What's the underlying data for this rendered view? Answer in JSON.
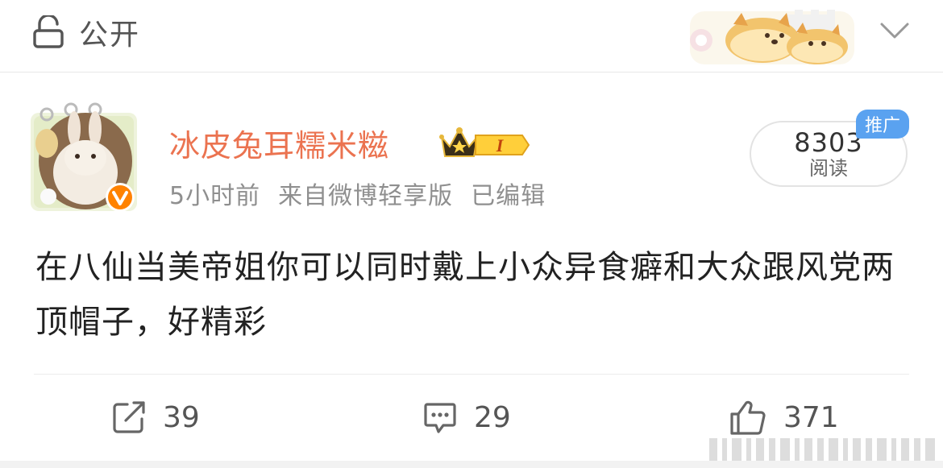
{
  "header": {
    "privacy_icon": "lock-open-icon",
    "privacy_label": "公开",
    "decoration": "shiba-bread-dogs-sticker",
    "menu_icon": "chevron-down-icon"
  },
  "post": {
    "author": {
      "name": "冰皮兔耳糯米糍",
      "avatar": "rabbit-avatar",
      "verified_icon": "orange-verified-badge-icon",
      "vip_badge": "crown-vip-level-badge",
      "vip_level": "I"
    },
    "time": "5小时前",
    "source": "来自微博轻享版",
    "edited": "已编辑",
    "reads": {
      "count": "8303",
      "label": "阅读",
      "promo_label": "推广"
    },
    "text": "在八仙当美帝姐你可以同时戴上小众异食癖和大众跟风党两顶帽子，好精彩"
  },
  "actions": {
    "repost": {
      "icon": "share-icon",
      "count": "39"
    },
    "comment": {
      "icon": "comment-icon",
      "count": "29"
    },
    "like": {
      "icon": "thumbs-up-icon",
      "count": "371"
    }
  },
  "colors": {
    "username": "#eb7350",
    "promo_tag": "#5aa2f0",
    "verified_badge": "#ff8200",
    "text": "#222222",
    "meta": "#8f8f8f"
  }
}
